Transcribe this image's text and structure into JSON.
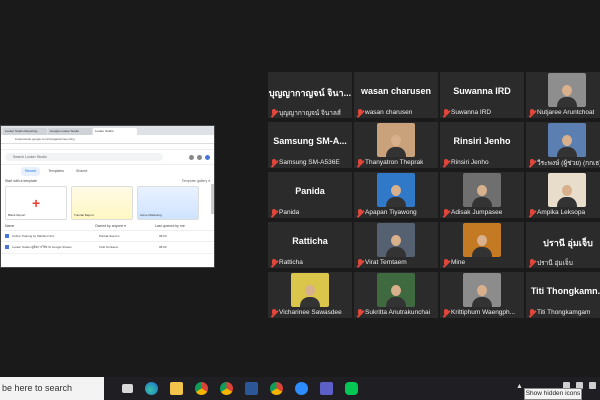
{
  "shared_window": {
    "tabs": [
      "Looker Studio Reporting",
      "Google Looker Studio",
      "Looker Studio"
    ],
    "address": "lookerstudio.google.com/navigation/reporting",
    "search_placeholder": "Search Looker Studio",
    "ls_tabs": [
      "Recent",
      "Templates",
      "Shared"
    ],
    "section_left": "Start with a template",
    "section_right": "Template gallery ▾",
    "tiles": [
      {
        "label": "Blank Report"
      },
      {
        "label": "Tutorial Report"
      },
      {
        "label": "Acme Marketing"
      }
    ],
    "list_head": {
      "name": "Name",
      "owner": "Owned by anyone ▾",
      "opened": "Last opened by me"
    },
    "list_rows": [
      {
        "name": "Online Training by Mahidol Univ",
        "owner": "Panida Sae-lim",
        "date": "08:09"
      },
      {
        "name": "Looker Studio คู่มือการใช้งาน Google Sheets",
        "owner": "Virat Temtaem",
        "date": "08:09"
      }
    ]
  },
  "participants": [
    {
      "big": "บุญญากาญจน์ จินา...",
      "name": "บุญญากาญจน์ จินาลส์",
      "photo": null
    },
    {
      "big": "wasan charusen",
      "name": "wasan charusen",
      "photo": null
    },
    {
      "big": "Suwanna IRD",
      "name": "Suwanna IRD",
      "photo": null
    },
    {
      "big": "",
      "name": "Nutjaree Aruntchoat",
      "photo": "#8e8e8e"
    },
    {
      "big": "Samsung SM-A...",
      "name": "Samsung SM-A536E",
      "photo": null
    },
    {
      "big": "",
      "name": "Thanyatron Theprak",
      "photo": "#c9a17a"
    },
    {
      "big": "Rinsiri Jenho",
      "name": "Rinsiri Jenho",
      "photo": null
    },
    {
      "big": "",
      "name": "วีระพงษ์ (ผู้ช่วย) (กกเธ)",
      "photo": "#5a7fb0"
    },
    {
      "big": "Panida",
      "name": "Panida",
      "photo": null
    },
    {
      "big": "",
      "name": "Apapan Tiyawong",
      "photo": "#2f79c8"
    },
    {
      "big": "",
      "name": "Adisak Jumpasee",
      "photo": "#6f6f6f"
    },
    {
      "big": "",
      "name": "Ampika Leksopa",
      "photo": "#e8dccb"
    },
    {
      "big": "Ratticha",
      "name": "Ratticha",
      "photo": null
    },
    {
      "big": "",
      "name": "Virat Temtaem",
      "photo": "#556070"
    },
    {
      "big": "",
      "name": "Mine",
      "photo": "#c47a22"
    },
    {
      "big": "ปรานี อุ่มเจ็บ",
      "name": "ปรานี อุ่มเจ็บ",
      "photo": null
    },
    {
      "big": "",
      "name": "Vicharinee Sawasdee",
      "photo": "#d9c64b"
    },
    {
      "big": "",
      "name": "Sukritta Anutrakunchai",
      "photo": "#3f6a3f"
    },
    {
      "big": "",
      "name": "Krittiphum Waengph...",
      "photo": "#8c8c8c"
    },
    {
      "big": "Titi Thongkamn...",
      "name": "Titi Thongkamgam",
      "photo": null
    }
  ],
  "taskbar": {
    "search_text": "be here to search",
    "tooltip": "Show hidden icons",
    "icons": [
      "task-view",
      "edge",
      "file-explorer",
      "chrome",
      "chrome-alt",
      "word",
      "chrome-3",
      "zoom",
      "teams",
      "line"
    ]
  }
}
